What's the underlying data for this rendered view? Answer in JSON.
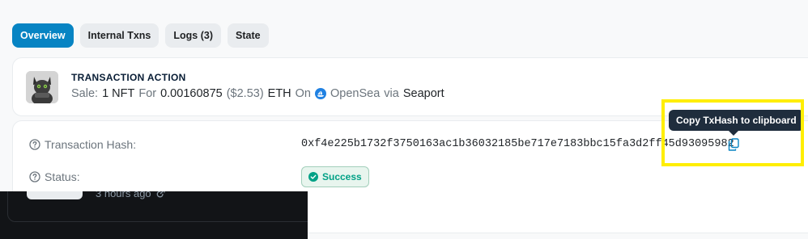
{
  "tabs": [
    {
      "label": "Overview",
      "active": true
    },
    {
      "label": "Internal Txns",
      "active": false
    },
    {
      "label": "Logs (3)",
      "active": false
    },
    {
      "label": "State",
      "active": false
    }
  ],
  "action": {
    "title": "TRANSACTION ACTION",
    "sale_label": "Sale:",
    "quantity": "1 NFT",
    "for_label": "For",
    "amount": "0.00160875",
    "usd": "($2.53)",
    "currency": "ETH",
    "on_label": "On",
    "marketplace": "OpenSea",
    "via_label": "via",
    "protocol": "Seaport"
  },
  "details": {
    "hash_label": "Transaction Hash:",
    "hash_value": "0xf4e225b1732f3750163ac1b36032185be717e7183bbc15fa3d2ff45d93095982",
    "status_label": "Status:",
    "status_value": "Success"
  },
  "tooltip": {
    "text": "Copy TxHash to clipboard"
  },
  "overlay": {
    "time_ago": "3 hours ago"
  },
  "colors": {
    "accent": "#0784c3",
    "success": "#00a186",
    "highlight": "#ffee00",
    "tooltip_bg": "#1f2d3d"
  },
  "icons": [
    "question-circle-icon",
    "copy-icon",
    "check-circle-icon",
    "opensea-icon",
    "external-link-icon"
  ]
}
